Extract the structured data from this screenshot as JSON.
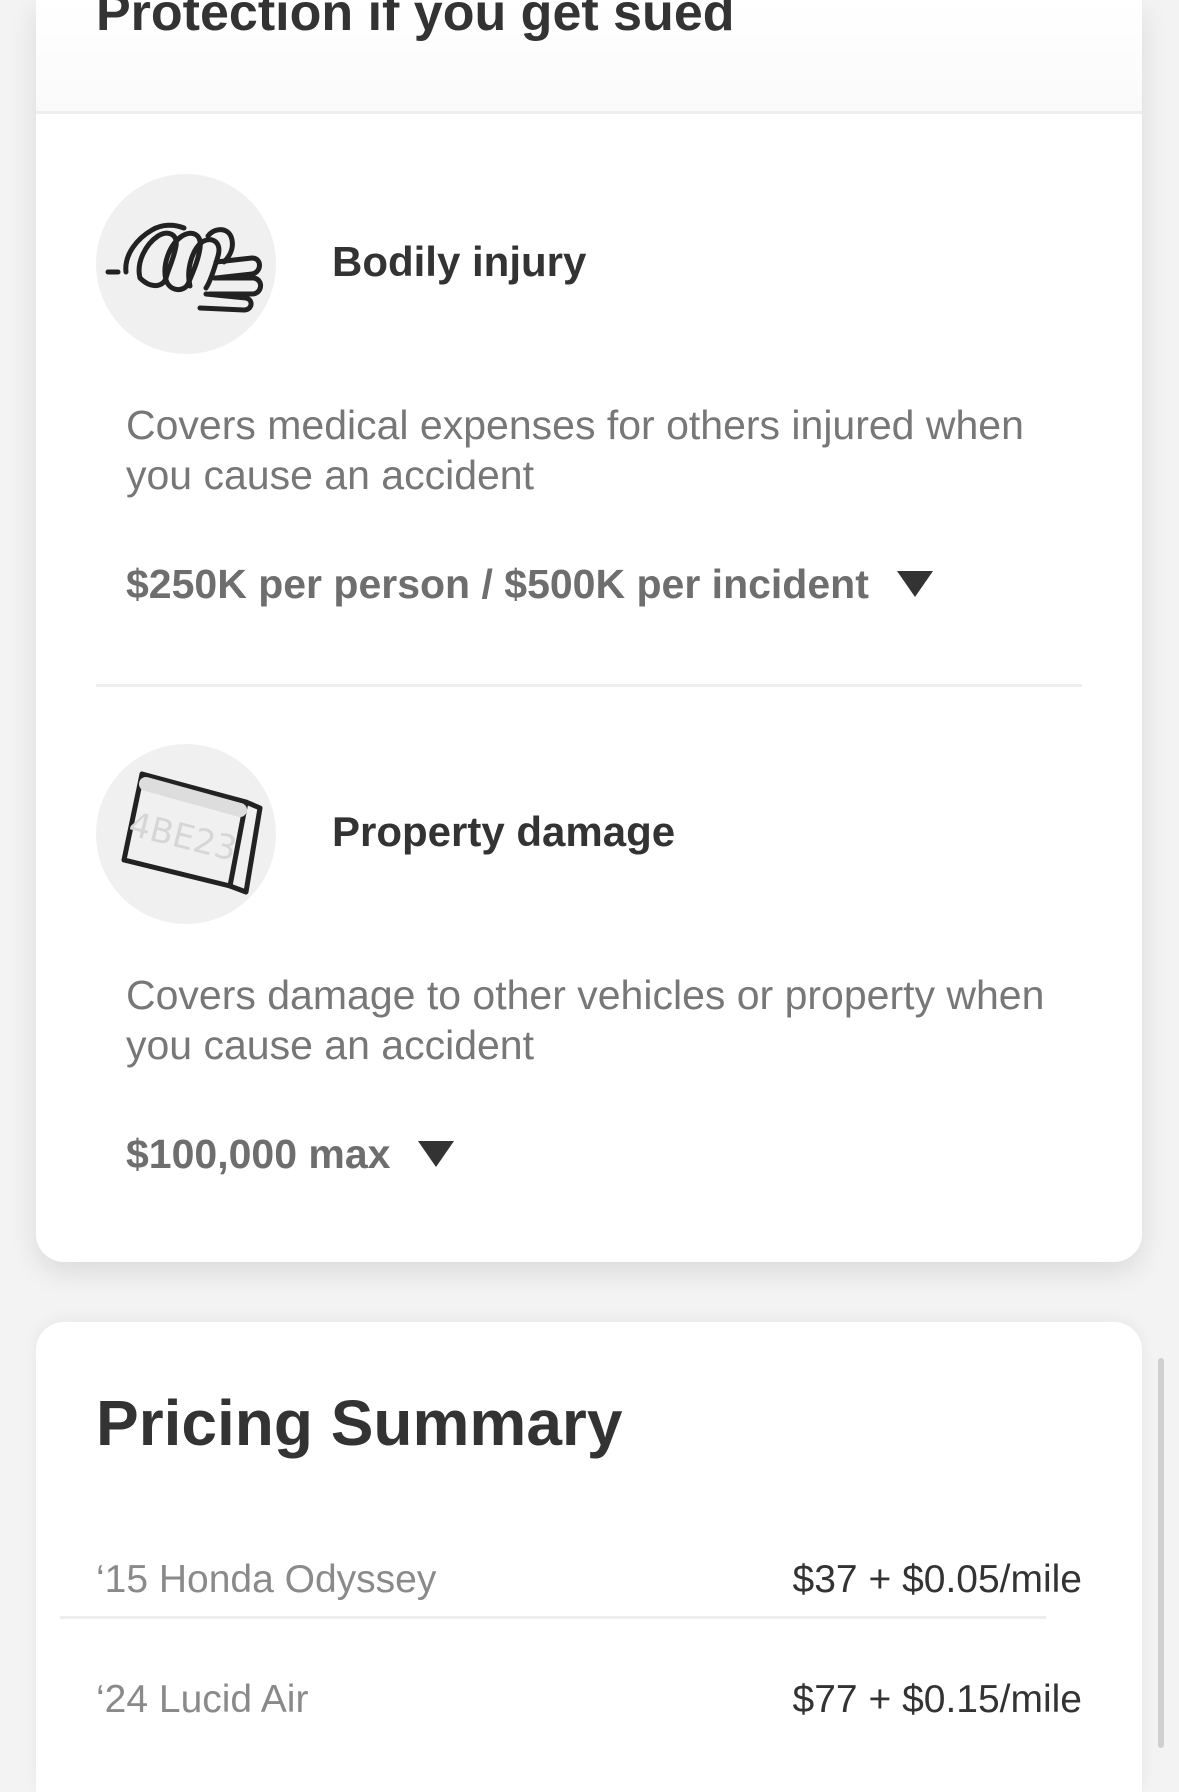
{
  "protection_section": {
    "title": "Protection if you get sued"
  },
  "coverages": [
    {
      "name": "Bodily injury",
      "icon": "handshake-icon",
      "description": "Covers medical expenses for others injured when you cause an accident",
      "limit": "$250K per person / $500K per incident"
    },
    {
      "name": "Property damage",
      "icon": "license-plate-icon",
      "icon_text": "4BE23",
      "description": "Covers damage to other vehicles or property when you cause an accident",
      "limit": "$100,000 max"
    }
  ],
  "pricing_summary": {
    "title": "Pricing Summary",
    "vehicles": [
      {
        "name": "‘15 Honda Odyssey",
        "price": "$37 + $0.05/mile"
      },
      {
        "name": "‘24 Lucid Air",
        "price": "$77 + $0.15/mile"
      }
    ]
  },
  "colors": {
    "background": "#f3f3f3",
    "card": "#ffffff",
    "heading": "#333333",
    "muted_text": "#777777",
    "icon_circle": "#f0f0f0"
  }
}
